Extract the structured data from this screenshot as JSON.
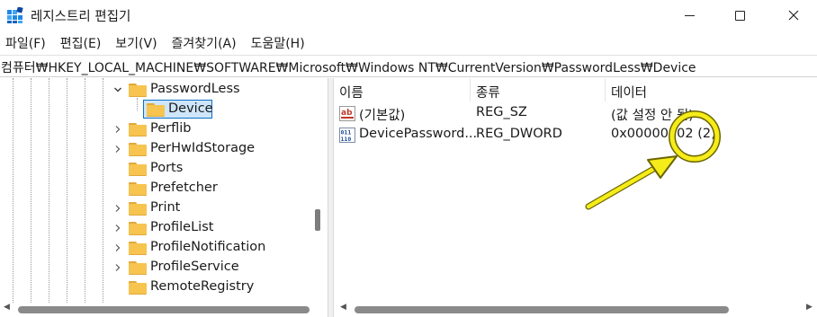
{
  "window": {
    "title": "레지스트리 편집기",
    "icon": "regedit-icon"
  },
  "menu": {
    "items": [
      "파일(F)",
      "편집(E)",
      "보기(V)",
      "즐겨찾기(A)",
      "도움말(H)"
    ]
  },
  "address": {
    "path": "컴퓨터₩HKEY_LOCAL_MACHINE₩SOFTWARE₩Microsoft₩Windows NT₩CurrentVersion₩PasswordLess₩Device"
  },
  "tree": {
    "items": [
      {
        "label": "PasswordLess",
        "state": "expanded"
      },
      {
        "label": "Device",
        "state": "selected"
      },
      {
        "label": "Perflib",
        "state": "collapsed"
      },
      {
        "label": "PerHwIdStorage",
        "state": "collapsed"
      },
      {
        "label": "Ports",
        "state": "leaf"
      },
      {
        "label": "Prefetcher",
        "state": "leaf"
      },
      {
        "label": "Print",
        "state": "collapsed"
      },
      {
        "label": "ProfileList",
        "state": "collapsed"
      },
      {
        "label": "ProfileNotification",
        "state": "collapsed"
      },
      {
        "label": "ProfileService",
        "state": "collapsed"
      },
      {
        "label": "RemoteRegistry",
        "state": "leaf"
      }
    ]
  },
  "list": {
    "columns": [
      "이름",
      "종류",
      "데이터"
    ],
    "rows": [
      {
        "name": "(기본값)",
        "type": "REG_SZ",
        "data": "(값 설정 안 됨)",
        "icon": "string-value-icon"
      },
      {
        "name": "DevicePassword...",
        "type": "REG_DWORD",
        "data": "0x00000002 (2)",
        "icon": "binary-value-icon"
      }
    ]
  },
  "annotation": {
    "color": "#f5ec1a",
    "outline": "#7a7200"
  }
}
